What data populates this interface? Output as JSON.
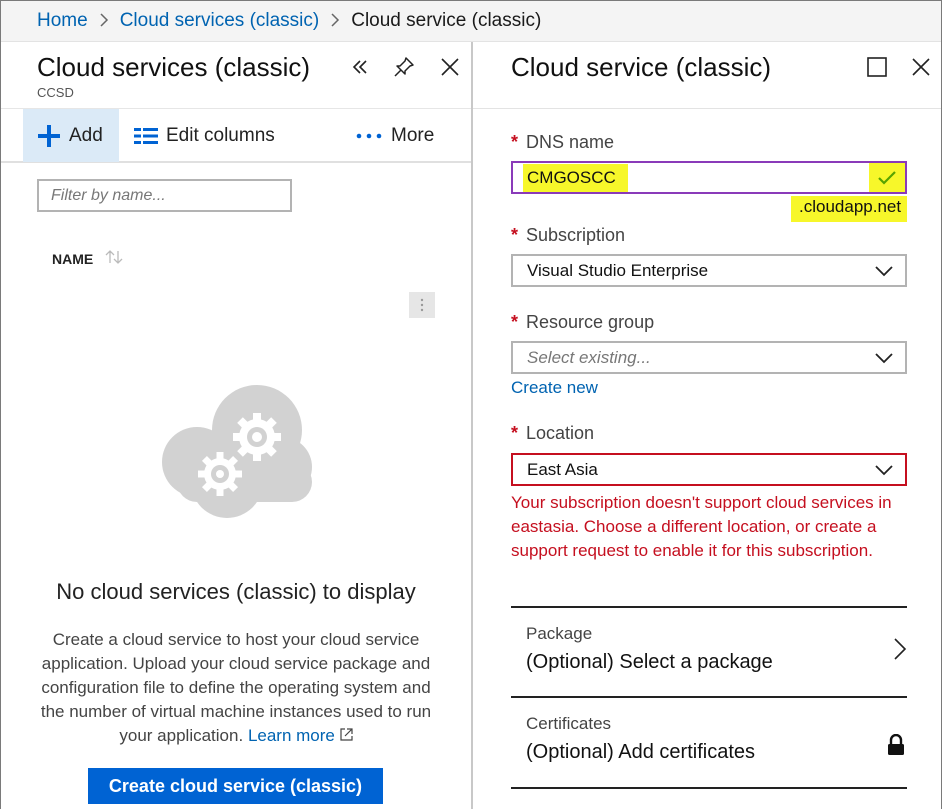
{
  "breadcrumb": {
    "items": [
      "Home",
      "Cloud services (classic)"
    ],
    "current": "Cloud service (classic)"
  },
  "left_blade": {
    "title": "Cloud services (classic)",
    "subtitle": "CCSD",
    "toolbar": {
      "add_label": "Add",
      "edit_columns_label": "Edit columns",
      "more_label": "More"
    },
    "filter_placeholder": "Filter by name...",
    "column_header": "NAME",
    "empty_title": "No cloud services (classic) to display",
    "empty_description": "Create a cloud service to host your cloud service application. Upload your cloud service package and configuration file to define the operating system and the number of virtual machine instances used to run your application.",
    "learn_more_label": "Learn more",
    "create_button_label": "Create cloud service (classic)"
  },
  "right_blade": {
    "title": "Cloud service (classic)",
    "dns": {
      "label": "DNS name",
      "value": "CMGOSCC",
      "suffix": ".cloudapp.net"
    },
    "subscription": {
      "label": "Subscription",
      "value": "Visual Studio Enterprise"
    },
    "resource_group": {
      "label": "Resource group",
      "placeholder": "Select existing...",
      "create_new_label": "Create new"
    },
    "location": {
      "label": "Location",
      "value": "East Asia",
      "error": "Your subscription doesn't support cloud services in eastasia. Choose a different location, or create a support request to enable it for this subscription."
    },
    "package": {
      "label": "Package",
      "value": "(Optional) Select a package"
    },
    "certificates": {
      "label": "Certificates",
      "value": "(Optional) Add certificates"
    }
  },
  "required_marker": "*",
  "colors": {
    "accent": "#0063d3",
    "link": "#0063b1",
    "error": "#c50f1f",
    "highlight": "#f7f72a",
    "dns_border": "#8a3ab9",
    "add_button_bg": "#dbeaf7"
  },
  "icons": [
    "chevron-right-icon",
    "collapse-icon",
    "pin-icon",
    "close-icon",
    "plus-icon",
    "columns-icon",
    "more-icon",
    "sort-icon",
    "context-menu-icon",
    "cloud-gears-icon",
    "external-link-icon",
    "maximize-icon",
    "checkmark-icon",
    "chevron-down-icon",
    "lock-icon"
  ]
}
